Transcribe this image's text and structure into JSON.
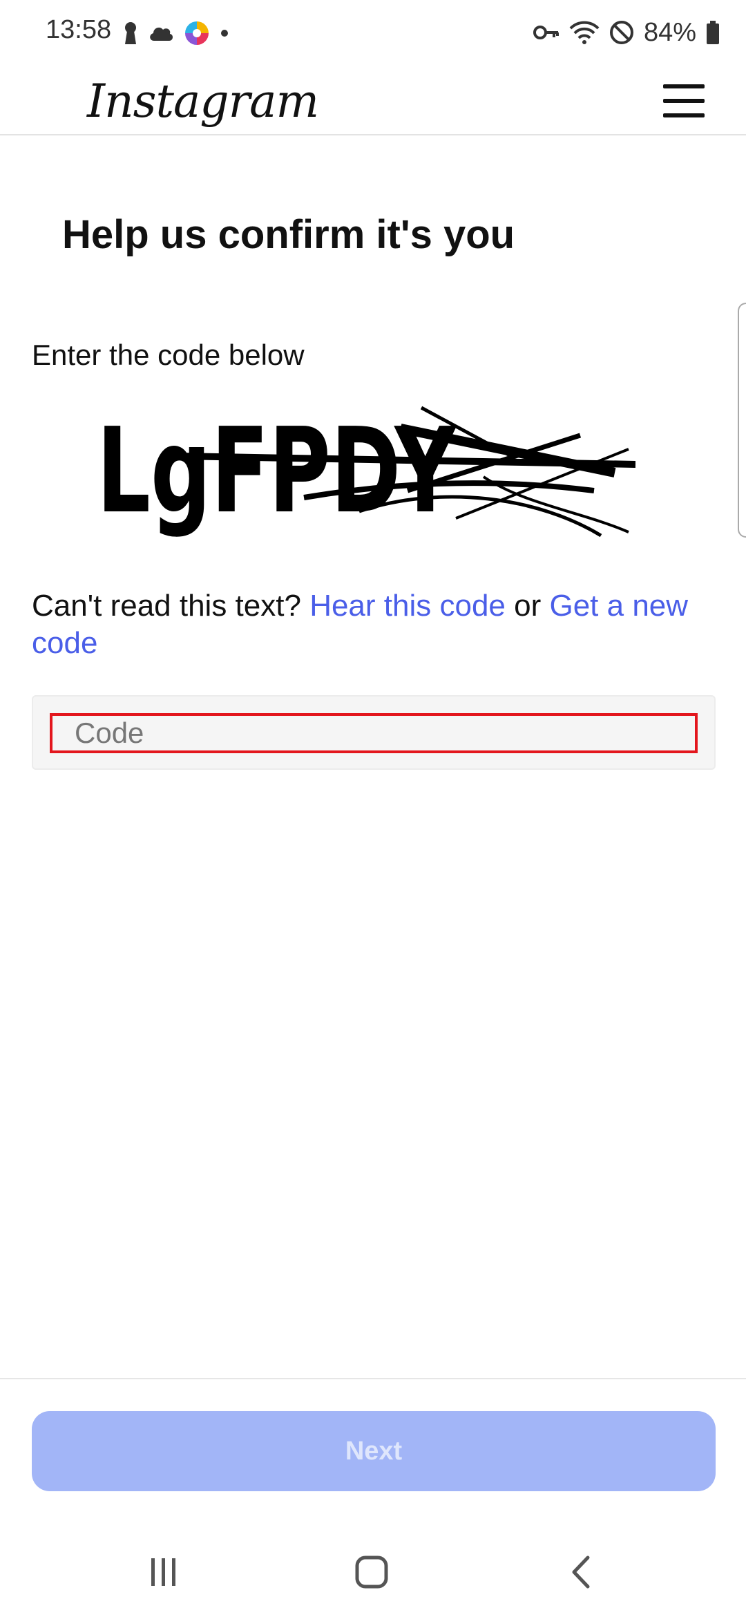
{
  "status_bar": {
    "time": "13:58",
    "battery_percent": "84%",
    "left_icons": [
      "keyhole-icon",
      "cloud-icon",
      "app-icon",
      "dot-icon"
    ],
    "right_icons": [
      "key-icon",
      "wifi-icon",
      "do-not-disturb-icon",
      "battery-icon"
    ]
  },
  "header": {
    "logo_text": "Instagram",
    "menu_icon": "hamburger-menu-icon"
  },
  "main": {
    "title": "Help us confirm it's you",
    "instruction": "Enter the code below",
    "captcha_text": "LgFPDY",
    "help_prefix": "Can't read this text?",
    "hear_link": "Hear this code",
    "or_text": "or",
    "new_code_link": "Get a new code",
    "code_placeholder": "Code",
    "code_value": ""
  },
  "footer": {
    "next_label": "Next"
  },
  "nav_bar": {
    "recents_icon": "recents-icon",
    "home_icon": "home-icon",
    "back_icon": "back-icon"
  },
  "colors": {
    "link": "#4a5ee8",
    "next_button_disabled": "#a2b5f7",
    "focus_outline": "#e3161d"
  }
}
